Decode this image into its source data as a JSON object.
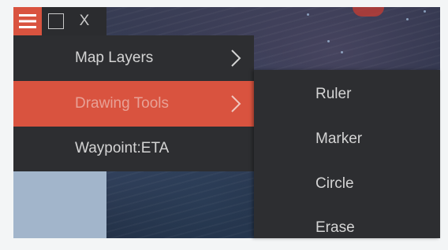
{
  "window_controls": {
    "menu_icon": "hamburger-icon",
    "maximize_icon": "maximize-icon",
    "close_label": "X"
  },
  "main_menu": {
    "items": [
      {
        "label": "Map Layers",
        "has_submenu": true,
        "active": false
      },
      {
        "label": "Drawing Tools",
        "has_submenu": true,
        "active": true
      },
      {
        "label": "Waypoint:ETA",
        "has_submenu": false,
        "active": false
      }
    ]
  },
  "drawing_tools_submenu": {
    "items": [
      {
        "label": "Ruler"
      },
      {
        "label": "Marker"
      },
      {
        "label": "Circle"
      },
      {
        "label": "Erase"
      }
    ]
  },
  "colors": {
    "accent": "#d9533f",
    "menu_bg": "#2d2e31",
    "menu_text": "#d4d4d4",
    "active_text": "#e8a196"
  }
}
